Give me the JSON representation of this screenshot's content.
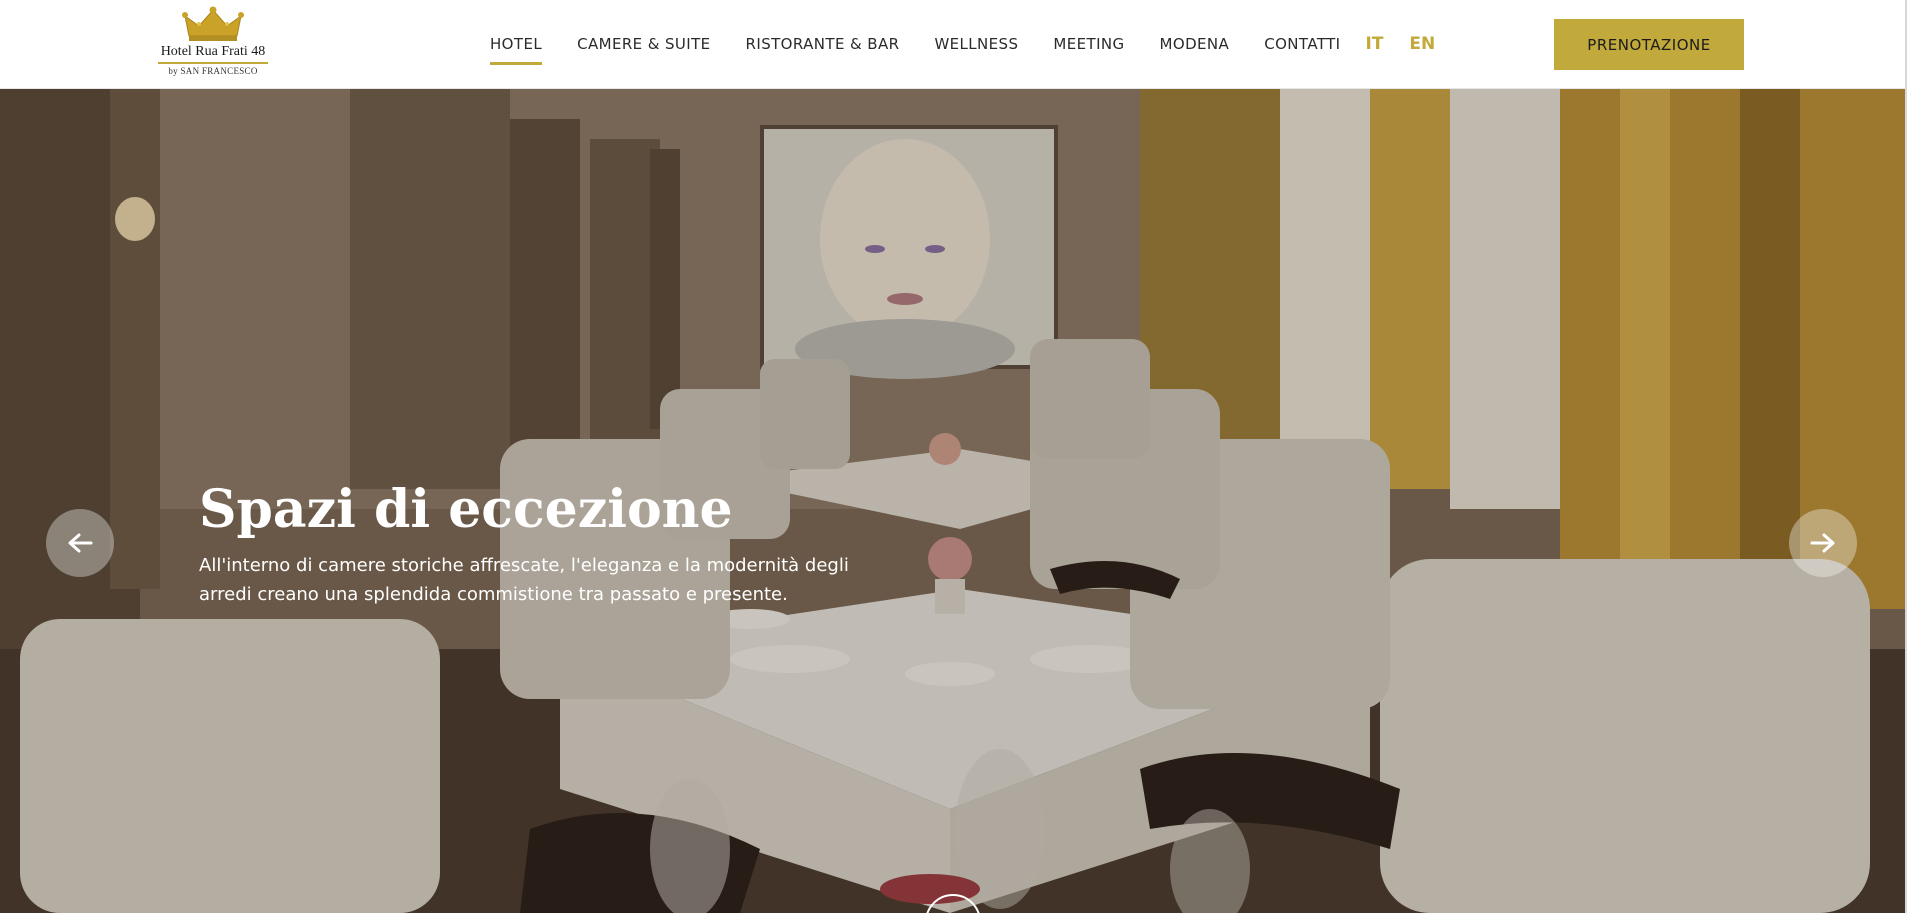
{
  "header": {
    "logo": {
      "name": "Hotel Rua Frati 48",
      "sub": "by SAN FRANCESCO",
      "icon": "crown-icon"
    },
    "nav": [
      {
        "label": "HOTEL",
        "active": true
      },
      {
        "label": "CAMERE & SUITE",
        "active": false
      },
      {
        "label": "RISTORANTE & BAR",
        "active": false
      },
      {
        "label": "WELLNESS",
        "active": false
      },
      {
        "label": "MEETING",
        "active": false
      },
      {
        "label": "MODENA",
        "active": false
      },
      {
        "label": "CONTATTI",
        "active": false
      }
    ],
    "languages": [
      "IT",
      "EN"
    ],
    "booking_label": "PRENOTAZIONE"
  },
  "hero": {
    "title": "Spazi di eccezione",
    "text": "All'interno di camere storiche affrescate, l'eleganza e la modernità degli arredi creano una splendida commistione tra passato e presente.",
    "prev_icon": "arrow-left-icon",
    "next_icon": "arrow-right-icon"
  },
  "colors": {
    "accent": "#c2a93b",
    "text_dark": "#2b2b2b"
  }
}
